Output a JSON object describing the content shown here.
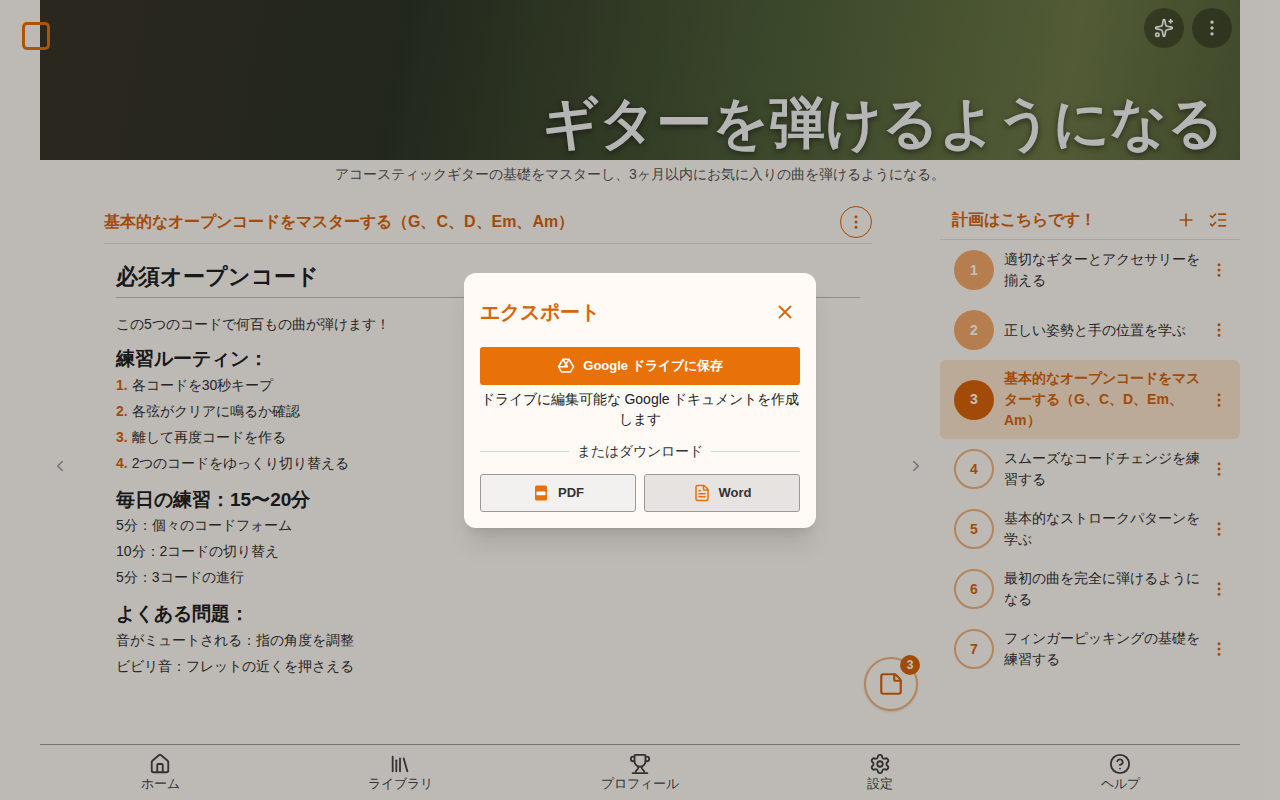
{
  "header": {
    "title": "ギターを弾けるようになる",
    "subtitle": "アコースティックギターの基礎をマスターし、3ヶ月以内にお気に入りの曲を弾けるようになる。"
  },
  "section": {
    "title": "基本的なオープンコードをマスターする（G、C、D、Em、Am）",
    "heading": "必須オープンコード",
    "intro": "この5つのコードで何百もの曲が弾けます！",
    "blocks": [
      {
        "heading": "練習ルーティン：",
        "kind": "ordered",
        "items": [
          {
            "marker": "1.",
            "text": "各コードを30秒キープ"
          },
          {
            "marker": "2.",
            "text": "各弦がクリアに鳴るか確認"
          },
          {
            "marker": "3.",
            "text": "離して再度コードを作る"
          },
          {
            "marker": "4.",
            "text": "2つのコードをゆっくり切り替える"
          }
        ]
      },
      {
        "heading": "毎日の練習：15〜20分",
        "kind": "plain",
        "items": [
          {
            "marker": "",
            "text": "5分：個々のコードフォーム"
          },
          {
            "marker": "",
            "text": "10分：2コードの切り替え"
          },
          {
            "marker": "",
            "text": "5分：3コードの進行"
          }
        ]
      },
      {
        "heading": "よくある問題：",
        "kind": "plain",
        "items": [
          {
            "marker": "",
            "text": "音がミュートされる：指の角度を調整"
          },
          {
            "marker": "",
            "text": "ビビリ音：フレットの近くを押さえる"
          }
        ]
      }
    ]
  },
  "plan": {
    "title": "計画はこちらです！",
    "steps": [
      {
        "number": "1",
        "label": "適切なギターとアクセサリーを揃える",
        "completed": true,
        "selected": false
      },
      {
        "number": "2",
        "label": "正しい姿勢と手の位置を学ぶ",
        "completed": true,
        "selected": false
      },
      {
        "number": "3",
        "label": "基本的なオープンコードをマスターする（G、C、D、Em、Am）",
        "completed": false,
        "selected": true
      },
      {
        "number": "4",
        "label": "スムーズなコードチェンジを練習する",
        "completed": false,
        "selected": false
      },
      {
        "number": "5",
        "label": "基本的なストロークパターンを学ぶ",
        "completed": false,
        "selected": false
      },
      {
        "number": "6",
        "label": "最初の曲を完全に弾けるようになる",
        "completed": false,
        "selected": false
      },
      {
        "number": "7",
        "label": "フィンガーピッキングの基礎を練習する",
        "completed": false,
        "selected": false
      }
    ]
  },
  "notes": {
    "badge": "3"
  },
  "nav": [
    {
      "label": "ホーム"
    },
    {
      "label": "ライブラリ"
    },
    {
      "label": "プロフィール"
    },
    {
      "label": "設定"
    },
    {
      "label": "ヘルプ"
    }
  ],
  "dialog": {
    "title": "エクスポート",
    "drive_button": "Google ドライブに保存",
    "description": "ドライブに編集可能な Google ドキュメントを作成します",
    "divider": "またはダウンロード",
    "downloads": [
      {
        "label": "PDF",
        "kind": "pdf",
        "highlighted": false
      },
      {
        "label": "Word",
        "kind": "word",
        "highlighted": true
      }
    ]
  }
}
